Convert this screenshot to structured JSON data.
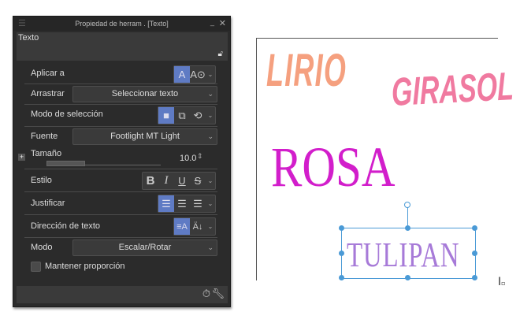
{
  "panel": {
    "title": "Propiedad de herram . [Texto]",
    "header": "Texto",
    "rows": {
      "apply_to": "Aplicar a",
      "drag": "Arrastrar",
      "drag_value": "Seleccionar texto",
      "selection_mode": "Modo de selección",
      "font": "Fuente",
      "font_value": "Footlight MT Light",
      "size": "Tamaño",
      "size_value": "10.0",
      "style": "Estilo",
      "justify": "Justificar",
      "direction": "Dirección de texto",
      "mode": "Modo",
      "mode_value": "Escalar/Rotar",
      "keep_ratio": "Mantener proporción"
    },
    "accent": "#5f7bc4"
  },
  "canvas": {
    "words": [
      {
        "text": "LIRIO",
        "color": "#f5a07f"
      },
      {
        "text": "GIRASOL",
        "color": "#f07aa0"
      },
      {
        "text": "ROSA",
        "color": "#d21ecb"
      },
      {
        "text": "TULIPAN",
        "color": "#a77ad8"
      }
    ],
    "selection_color": "#4a9ad6"
  }
}
